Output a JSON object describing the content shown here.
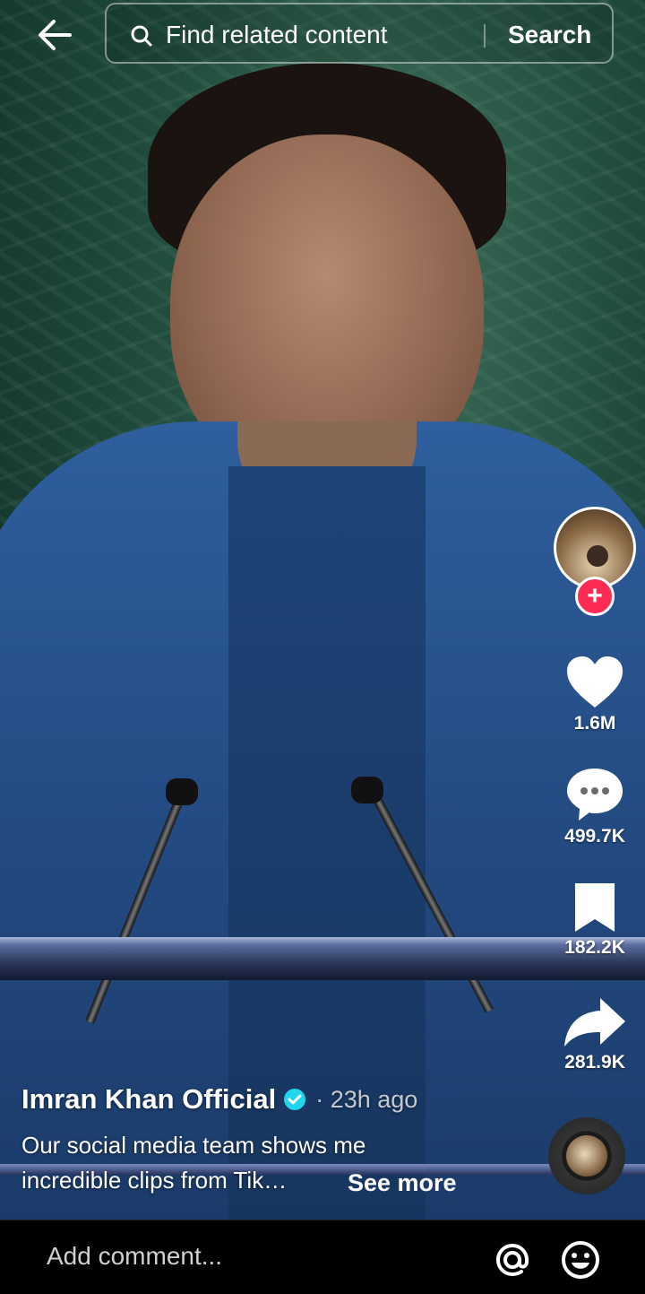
{
  "search": {
    "placeholder": "Find related content",
    "button_label": "Search"
  },
  "actions": {
    "likes": "1.6M",
    "comments": "499.7K",
    "saves": "182.2K",
    "shares": "281.9K"
  },
  "post": {
    "author": "Imran Khan Official",
    "time": "· 23h ago",
    "description": "Our social media team shows me incredible clips from Tik…",
    "see_more": "See more",
    "verified": true
  },
  "comment_bar": {
    "placeholder": "Add comment..."
  },
  "colors": {
    "follow_plus": "#fe2c55",
    "verified": "#20d5ec"
  },
  "icons": [
    "back-arrow-icon",
    "search-icon",
    "heart-icon",
    "comment-icon",
    "bookmark-icon",
    "share-icon",
    "verified-icon",
    "music-disc-icon",
    "at-icon",
    "emoji-icon",
    "plus-icon"
  ]
}
